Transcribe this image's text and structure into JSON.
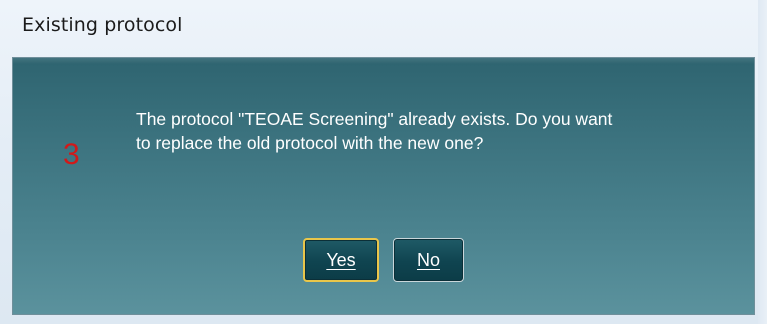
{
  "window": {
    "title": "Existing protocol"
  },
  "dialog": {
    "step_number": "3",
    "message": "The protocol \"TEOAE Screening\" already exists. Do you want\nto replace the old protocol with the new one?",
    "buttons": {
      "yes_label": "Yes",
      "no_label": "No"
    }
  },
  "colors": {
    "step_number": "#d11a1a",
    "dialog_background": "#3b727e",
    "button_background": "#0f4450",
    "default_button_border": "#e9c64a"
  }
}
